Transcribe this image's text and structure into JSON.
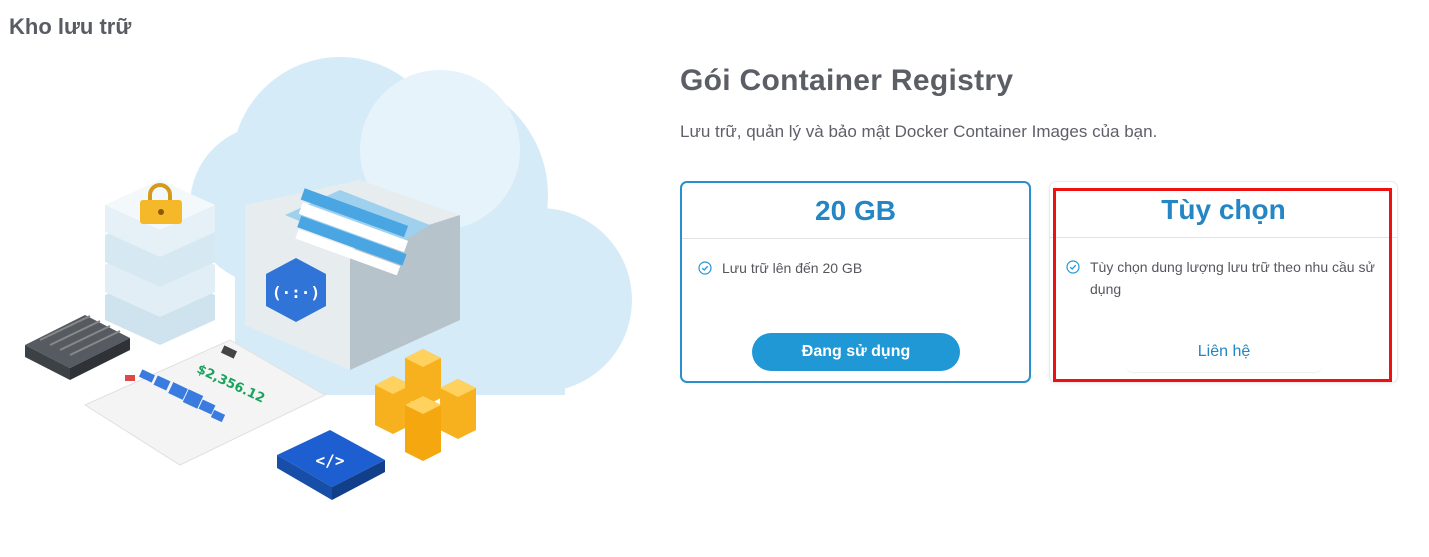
{
  "section": {
    "title": "Kho lưu trữ"
  },
  "product": {
    "title": "Gói Container Registry",
    "description": "Lưu trữ, quản lý và bảo mật Docker Container Images của bạn."
  },
  "plans": [
    {
      "name": "20 GB",
      "features": [
        "Lưu trữ lên đến 20 GB"
      ],
      "cta": "Đang sử dụng",
      "status": "active"
    },
    {
      "name": "Tùy chọn",
      "features": [
        "Tùy chọn dung lượng lưu trữ theo nhu cầu sử dụng"
      ],
      "cta": "Liên hệ",
      "status": "available"
    }
  ],
  "illustration": {
    "price_label": "$2,356.12",
    "code_badge": "</>"
  },
  "colors": {
    "accent": "#2486c4",
    "button": "#2198d6",
    "highlight": "#ee1111",
    "cloud": "#d3e9f7"
  },
  "icons": [
    "check-circle-icon",
    "lock-icon",
    "registry-hexagon-icon",
    "code-icon"
  ]
}
